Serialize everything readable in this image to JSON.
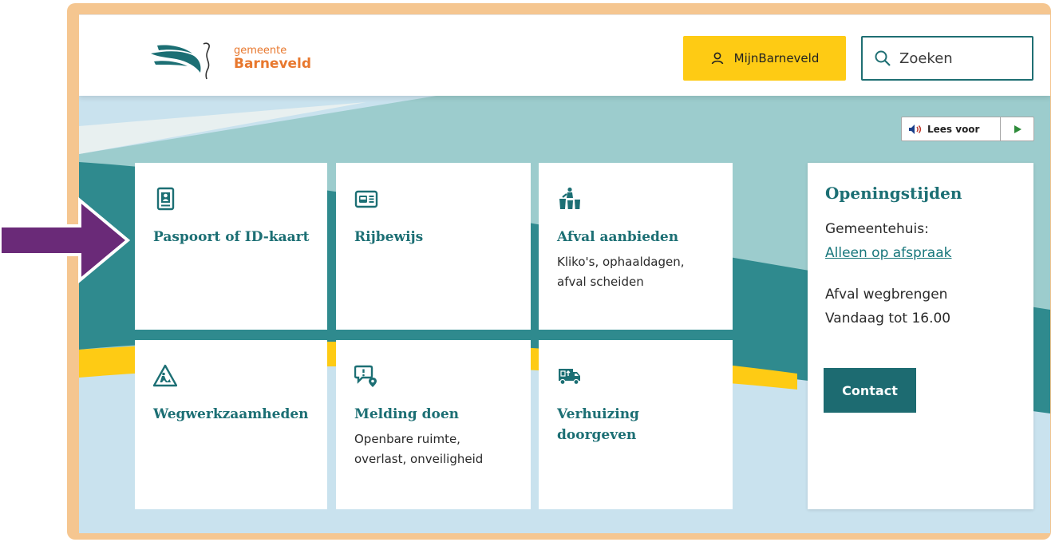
{
  "header": {
    "logo_small": "gemeente",
    "logo_big": "Barneveld",
    "mijn_label": "MijnBarneveld",
    "search_label": "Zoeken"
  },
  "readspeaker": {
    "label": "Lees voor"
  },
  "tiles": [
    {
      "title": "Paspoort of ID-kaart",
      "subtitle": "",
      "icon": "passport-icon"
    },
    {
      "title": "Rijbewijs",
      "subtitle": "",
      "icon": "driving-license-icon"
    },
    {
      "title": "Afval aanbieden",
      "subtitle": "Kliko's, ophaaldagen, afval scheiden",
      "icon": "waste-bins-icon"
    },
    {
      "title": "Wegwerkzaamheden",
      "subtitle": "",
      "icon": "roadworks-icon"
    },
    {
      "title": "Melding doen",
      "subtitle": "Openbare ruimte, overlast, onveiligheid",
      "icon": "report-location-icon"
    },
    {
      "title": "Verhuizing doorgeven",
      "subtitle": "",
      "icon": "moving-truck-icon"
    }
  ],
  "hours": {
    "title": "Openingstijden",
    "building": "Gemeentehuis:",
    "appointment_link": "Alleen op afspraak",
    "waste_line1": "Afval wegbrengen",
    "waste_line2": "Vandaag tot 16.00",
    "contact_label": "Contact"
  },
  "colors": {
    "frame": "#f5c690",
    "primary": "#1c6f74",
    "yellow": "#fecb14",
    "arrow": "#6a2a78"
  }
}
